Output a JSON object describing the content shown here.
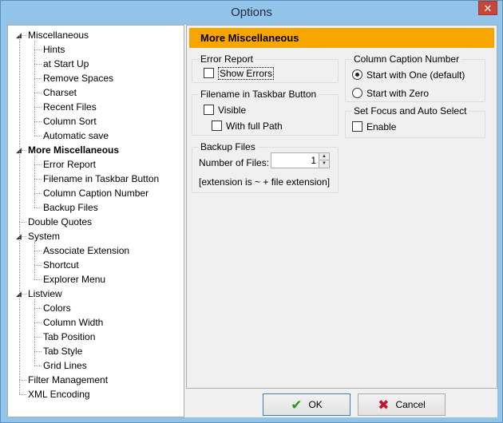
{
  "window": {
    "title": "Options",
    "close_label": "✕"
  },
  "tree": {
    "items": [
      {
        "label": "Miscellaneous",
        "level": 0,
        "expandable": true
      },
      {
        "label": "Hints",
        "level": 1
      },
      {
        "label": "at Start Up",
        "level": 1
      },
      {
        "label": "Remove Spaces",
        "level": 1
      },
      {
        "label": "Charset",
        "level": 1
      },
      {
        "label": "Recent Files",
        "level": 1
      },
      {
        "label": "Column Sort",
        "level": 1
      },
      {
        "label": "Automatic save",
        "level": 1
      },
      {
        "label": "More Miscellaneous",
        "level": 0,
        "expandable": true,
        "selected": true
      },
      {
        "label": "Error Report",
        "level": 1
      },
      {
        "label": "Filename in Taskbar Button",
        "level": 1
      },
      {
        "label": "Column Caption Number",
        "level": 1
      },
      {
        "label": "Backup Files",
        "level": 1
      },
      {
        "label": "Double Quotes",
        "level": 0
      },
      {
        "label": "System",
        "level": 0,
        "expandable": true
      },
      {
        "label": "Associate Extension",
        "level": 1
      },
      {
        "label": "Shortcut",
        "level": 1
      },
      {
        "label": "Explorer Menu",
        "level": 1
      },
      {
        "label": "Listview",
        "level": 0,
        "expandable": true
      },
      {
        "label": "Colors",
        "level": 1
      },
      {
        "label": "Column Width",
        "level": 1
      },
      {
        "label": "Tab Position",
        "level": 1
      },
      {
        "label": "Tab Style",
        "level": 1
      },
      {
        "label": "Grid Lines",
        "level": 1
      },
      {
        "label": "Filter Management",
        "level": 0
      },
      {
        "label": "XML Encoding",
        "level": 0
      }
    ]
  },
  "pane": {
    "header": "More Miscellaneous",
    "error_report": {
      "title": "Error Report",
      "show_errors": "Show Errors"
    },
    "filename_taskbar": {
      "title": "Filename in Taskbar Button",
      "visible": "Visible",
      "full_path": "With full Path"
    },
    "backup": {
      "title": "Backup Files",
      "number_label": "Number of Files:",
      "number_value": "1",
      "note": "[extension is ~ + file extension]"
    },
    "caption_number": {
      "title": "Column Caption Number",
      "start_one": "Start with One (default)",
      "start_zero": "Start with Zero"
    },
    "focus": {
      "title": "Set Focus and Auto Select",
      "enable": "Enable"
    }
  },
  "buttons": {
    "ok": "OK",
    "cancel": "Cancel"
  },
  "colors": {
    "header": "#f7a600",
    "titlebar": "#92c3e9",
    "close": "#c7463a"
  }
}
